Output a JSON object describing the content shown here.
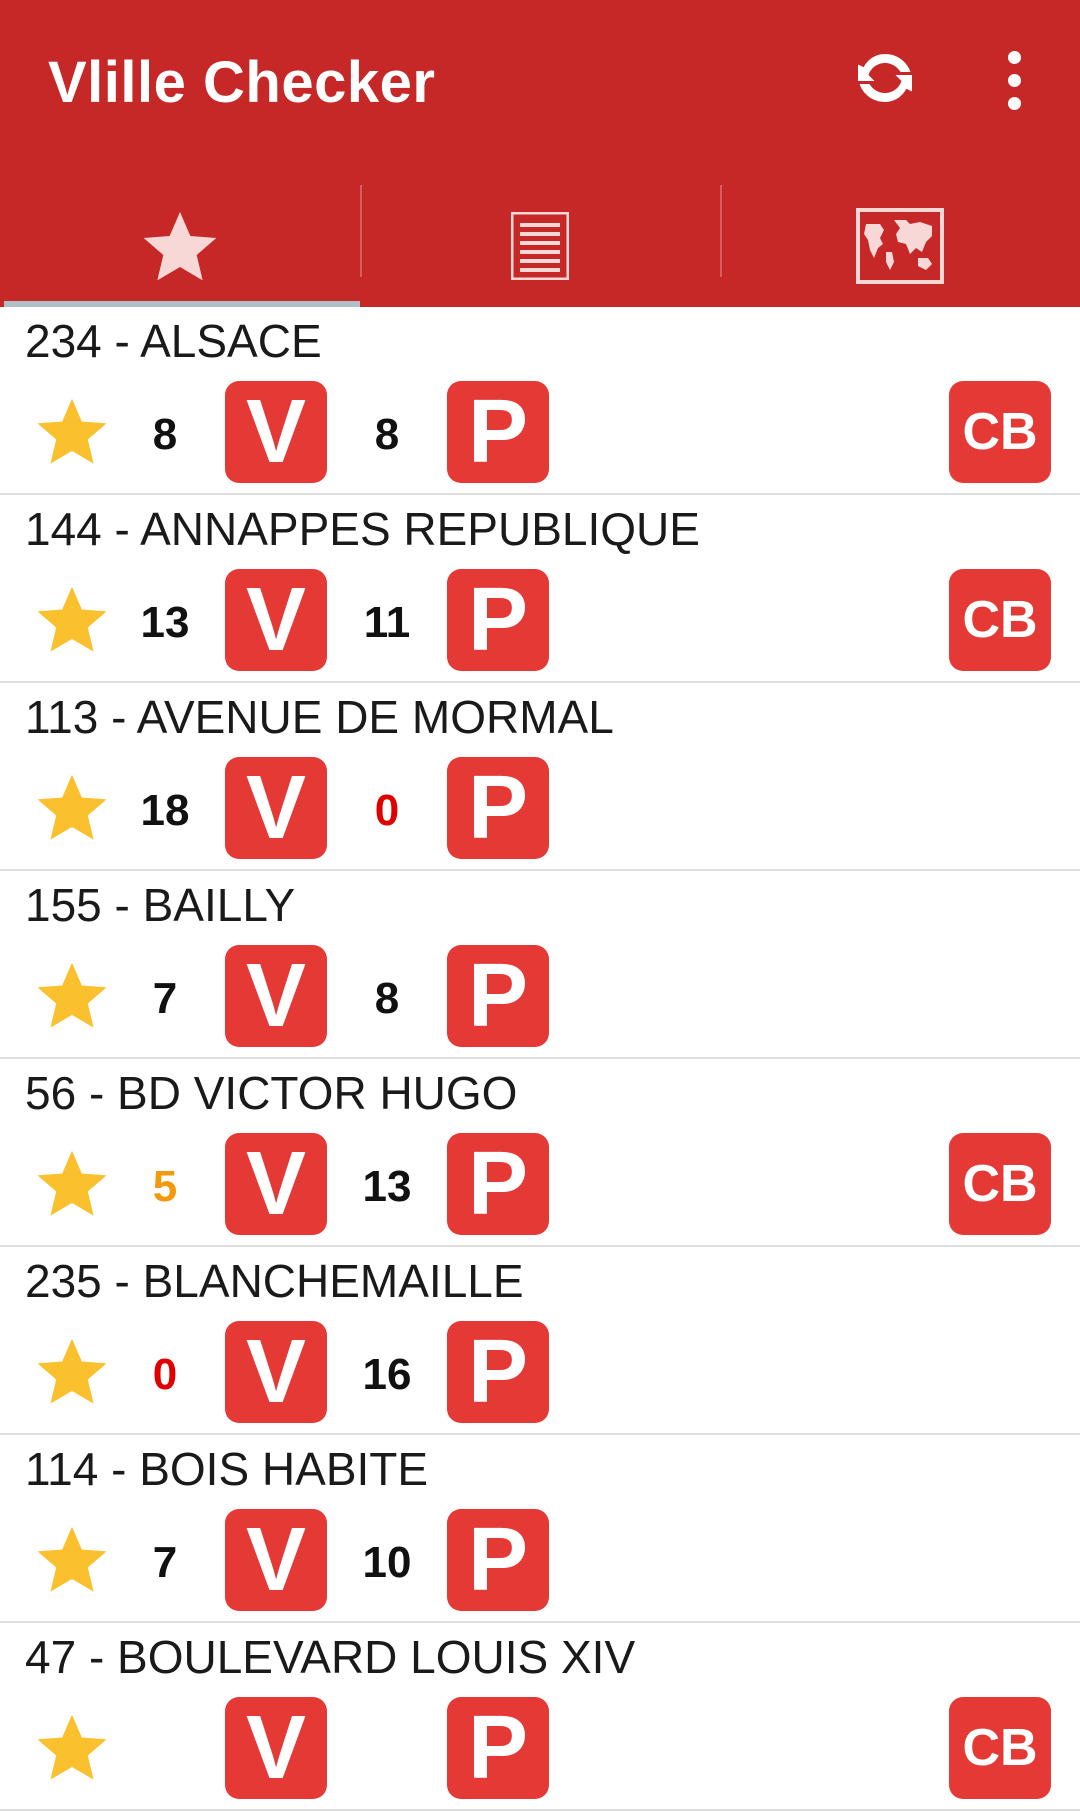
{
  "app": {
    "title": "Vlille Checker",
    "refresh_icon": "refresh-icon",
    "menu_icon": "more-vert-icon",
    "bar_color": "#c62828"
  },
  "tabs": [
    {
      "icon": "star-icon",
      "selected": true
    },
    {
      "icon": "list-icon",
      "selected": false
    },
    {
      "icon": "world-map-icon",
      "selected": false
    }
  ],
  "badges": {
    "bikes_letter": "V",
    "places_letter": "P",
    "card_label": "CB",
    "color": "#e53935"
  },
  "stations": [
    {
      "name": "234 - ALSACE",
      "bikes": "8",
      "places": "8",
      "cb": true
    },
    {
      "name": "144 - ANNAPPES REPUBLIQUE",
      "bikes": "13",
      "places": "11",
      "cb": true
    },
    {
      "name": "113 - AVENUE DE MORMAL",
      "bikes": "18",
      "places": "0",
      "cb": false
    },
    {
      "name": "155 - BAILLY",
      "bikes": "7",
      "places": "8",
      "cb": false
    },
    {
      "name": "56 - BD VICTOR HUGO",
      "bikes": "5",
      "places": "13",
      "cb": true
    },
    {
      "name": "235 - BLANCHEMAILLE",
      "bikes": "0",
      "places": "16",
      "cb": false
    },
    {
      "name": "114 - BOIS HABITE",
      "bikes": "7",
      "places": "10",
      "cb": false
    },
    {
      "name": "47 - BOULEVARD LOUIS XIV",
      "bikes": "",
      "places": "",
      "cb": true
    }
  ],
  "colors": {
    "zero": "#e00000",
    "low": "#f39a0c",
    "normal": "#111111",
    "star": "#fbc02d"
  }
}
